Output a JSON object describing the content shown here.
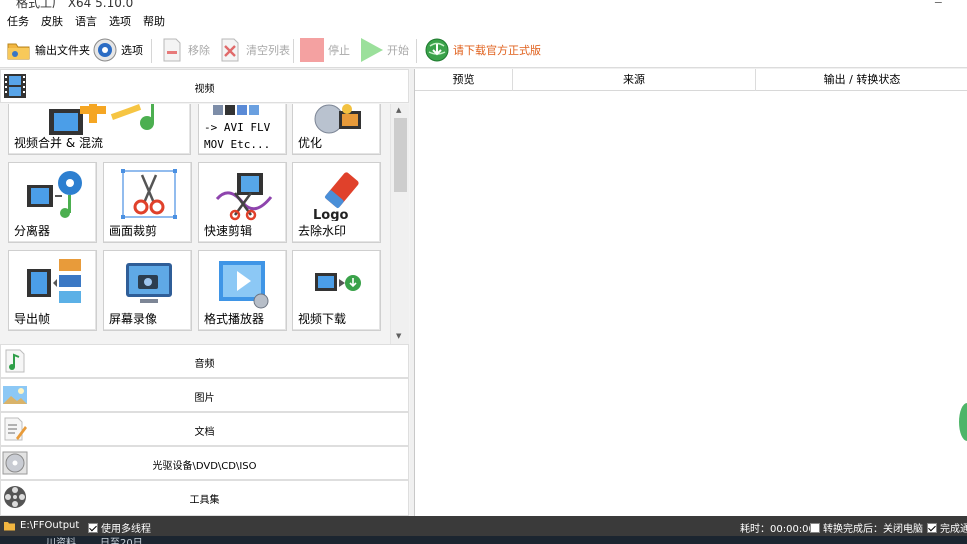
{
  "window": {
    "title": "格式工厂  X64 5.10.0",
    "close_glyph": "−"
  },
  "menu": [
    "任务",
    "皮肤",
    "语言",
    "选项",
    "帮助"
  ],
  "toolbar": {
    "output_folder": "输出文件夹",
    "options": "选项",
    "remove": "移除",
    "clear_list": "清空列表",
    "stop": "停止",
    "start": "开始",
    "upgrade": "请下载官方正式版",
    "upgrade_color": "#e0601c"
  },
  "categories": {
    "video": "视频",
    "audio": "音频",
    "image": "图片",
    "document": "文档",
    "disc": "光驱设备\\DVD\\CD\\ISO",
    "tools": "工具集"
  },
  "video_tiles": {
    "merge_mux": "视频合并 & 混流",
    "format_line1": "-> AVI FLV",
    "format_line2": "MOV Etc...",
    "optimize": "优化",
    "splitter": "分离器",
    "crop": "画面裁剪",
    "quick_clip": "快速剪辑",
    "watermark_remove": "去除水印",
    "export_frames": "导出帧",
    "screen_record": "屏幕录像",
    "player": "格式播放器",
    "video_download": "视频下载",
    "logo_text": "Logo"
  },
  "task_list": {
    "columns": [
      "预览",
      "来源",
      "输出 / 转换状态"
    ]
  },
  "status": {
    "output_path": "E:\\FFOutput",
    "multithread_label": "使用多线程",
    "multithread_checked": true,
    "elapsed": "耗时：00:00:00",
    "after_convert_label": "转换完成后：关闭电脑",
    "after_convert_checked": false,
    "complete_notify_label": "完成通",
    "complete_notify_checked": true
  },
  "taskbar": {
    "item1": "川资料",
    "item2": "日至20日..."
  }
}
